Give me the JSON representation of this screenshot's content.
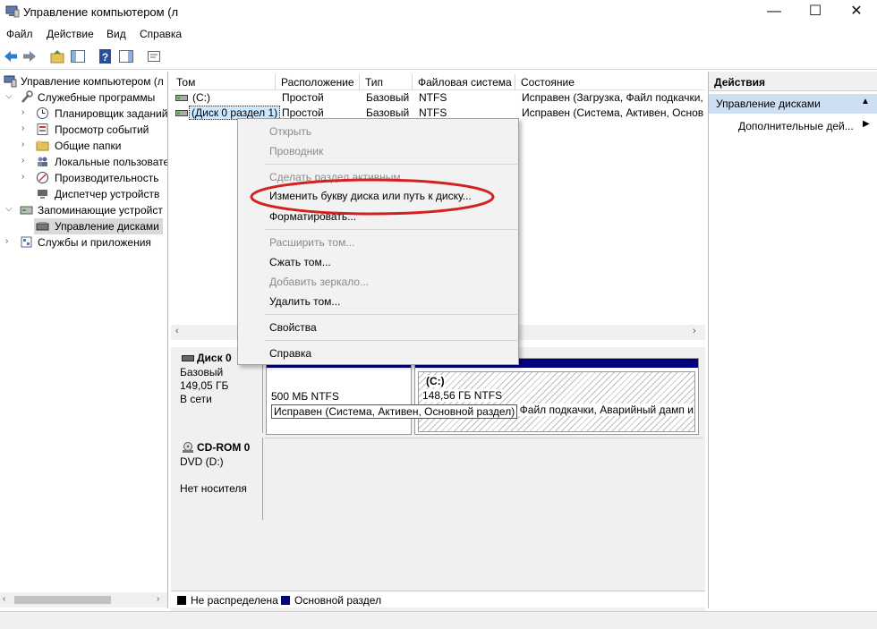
{
  "window": {
    "title": "Управление компьютером (л",
    "minimize": "—",
    "maximize": "☐",
    "close": "✕"
  },
  "menubar": [
    "Файл",
    "Действие",
    "Вид",
    "Справка"
  ],
  "tree": {
    "root": "Управление компьютером (л",
    "utilities": "Служебные программы",
    "task_scheduler": "Планировщик заданий",
    "event_viewer": "Просмотр событий",
    "shared_folders": "Общие папки",
    "local_users": "Локальные пользовате",
    "performance": "Производительность",
    "device_manager": "Диспетчер устройств",
    "storage": "Запоминающие устройст",
    "disk_management": "Управление дисками",
    "services": "Службы и приложения"
  },
  "volume_table": {
    "columns": [
      "Том",
      "Расположение",
      "Тип",
      "Файловая система",
      "Состояние"
    ],
    "rows": [
      {
        "volume": "(C:)",
        "layout": "Простой",
        "type": "Базовый",
        "fs": "NTFS",
        "status": "Исправен (Загрузка, Файл подкачки,"
      },
      {
        "volume": "(Диск 0 раздел 1)",
        "layout": "Простой",
        "type": "Базовый",
        "fs": "NTFS",
        "status": "Исправен (Система, Активен, Основ"
      }
    ]
  },
  "disks": {
    "disk0": {
      "name": "Диск 0",
      "type": "Базовый",
      "size": "149,05 ГБ",
      "state": "В сети"
    },
    "partition1": {
      "size": "500 МБ NTFS",
      "status": "Исправен (Система, Активен, Основной раздел)"
    },
    "partition_c": {
      "name": "(C:)",
      "size": "148,56 ГБ NTFS",
      "status": ", Файл подкачки, Аварийный дамп и"
    },
    "cdrom": {
      "name": "CD-ROM 0",
      "drive": "DVD (D:)",
      "state": "Нет носителя"
    }
  },
  "legend": {
    "unallocated": "Не распределена",
    "primary": "Основной раздел",
    "unallocated_color": "#000000",
    "primary_color": "#000080"
  },
  "actions": {
    "header": "Действия",
    "section": "Управление дисками",
    "more": "Дополнительные дей..."
  },
  "context_menu": {
    "open": "Открыть",
    "explore": "Проводник",
    "mark_active": "Сделать раздел активным",
    "change_letter": "Изменить букву диска или путь к диску...",
    "format": "Форматировать...",
    "extend": "Расширить том...",
    "shrink": "Сжать том...",
    "add_mirror": "Добавить зеркало...",
    "delete": "Удалить том...",
    "properties": "Свойства",
    "help": "Справка"
  },
  "colors": {
    "selection": "#cce8ff",
    "partition_bar": "#000080",
    "highlight_ellipse": "#d42020"
  }
}
